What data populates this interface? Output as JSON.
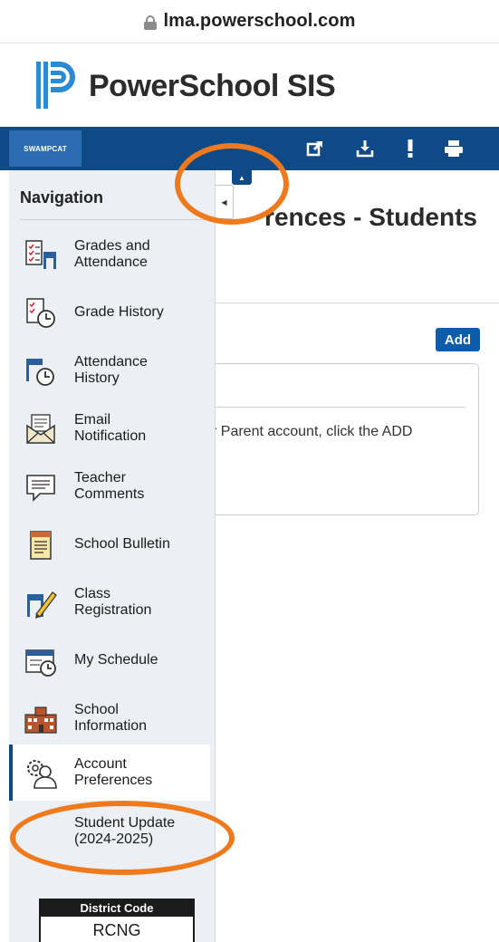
{
  "browser": {
    "url": "lma.powerschool.com"
  },
  "header": {
    "logo_text": "PowerSchool SIS",
    "username": "SWAMPCAT"
  },
  "toolbar": {
    "icons": [
      "external-link-icon",
      "download-icon",
      "alert-icon",
      "printer-icon"
    ]
  },
  "sidebar": {
    "title": "Navigation",
    "items": [
      {
        "label": "Grades and Attendance",
        "icon": "grades-attendance-icon"
      },
      {
        "label": "Grade History",
        "icon": "grade-history-icon"
      },
      {
        "label": "Attendance History",
        "icon": "attendance-history-icon"
      },
      {
        "label": "Email Notification",
        "icon": "email-icon"
      },
      {
        "label": "Teacher Comments",
        "icon": "comments-icon"
      },
      {
        "label": "School Bulletin",
        "icon": "bulletin-icon"
      },
      {
        "label": "Class Registration",
        "icon": "class-registration-icon"
      },
      {
        "label": "My Schedule",
        "icon": "schedule-icon"
      },
      {
        "label": "School Information",
        "icon": "school-icon"
      },
      {
        "label": "Account Preferences",
        "icon": "account-preferences-icon",
        "active": true
      }
    ],
    "sub_item": "Student Update (2024-2025)",
    "district": {
      "header": "District Code",
      "code": "RCNG"
    }
  },
  "main": {
    "title": "rences - Students",
    "add_button": "Add",
    "message": "r Parent account, click the ADD"
  },
  "colors": {
    "brand_blue": "#0f4a87",
    "button_blue": "#0b5cab",
    "annotation_orange": "#ee7a1d",
    "sidebar_bg": "#eceff3"
  }
}
